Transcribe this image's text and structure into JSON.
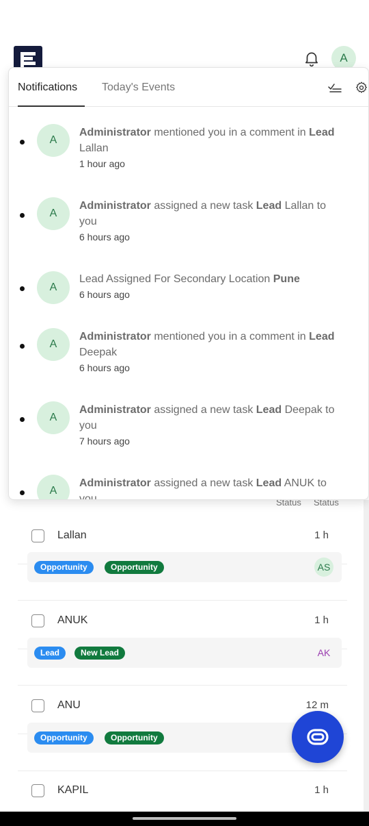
{
  "header": {
    "avatar_initial": "A"
  },
  "notifications_panel": {
    "tabs": [
      {
        "label": "Notifications",
        "active": true
      },
      {
        "label": "Today's Events",
        "active": false
      }
    ],
    "items": [
      {
        "avatar": "A",
        "actor": "Administrator",
        "text1": " mentioned you in a comment in ",
        "bold2": "Lead",
        "text2": "",
        "line2": "Lallan",
        "ago": "1 hour ago"
      },
      {
        "avatar": "A",
        "actor": "Administrator",
        "text1": " assigned a new task ",
        "bold2": "Lead",
        "text2": " Lallan to",
        "line2": "you",
        "ago": "6 hours ago"
      },
      {
        "avatar": "A",
        "actor": "",
        "text1": "Lead Assigned For Secondary Location ",
        "bold2": "Pune",
        "text2": "",
        "line2": "",
        "ago": "6 hours ago"
      },
      {
        "avatar": "A",
        "actor": "Administrator",
        "text1": " mentioned you in a comment in ",
        "bold2": "Lead",
        "text2": "",
        "line2": "Deepak",
        "ago": "6 hours ago"
      },
      {
        "avatar": "A",
        "actor": "Administrator",
        "text1": " assigned a new task ",
        "bold2": "Lead",
        "text2": " Deepak to",
        "line2": "you",
        "ago": "7 hours ago"
      },
      {
        "avatar": "A",
        "actor": "Administrator",
        "text1": " assigned a new task ",
        "bold2": "Lead",
        "text2": " ANUK to",
        "line2": "you",
        "ago": ""
      }
    ]
  },
  "list": {
    "column_headers": [
      "Status",
      "Status"
    ],
    "rows": [
      {
        "name": "Lallan",
        "time": "1 h",
        "tags": [
          {
            "label": "Opportunity",
            "color": "#2b8cf0"
          },
          {
            "label": "Opportunity",
            "color": "#117a3e"
          }
        ],
        "initials": "AS",
        "initials_color": "#2b7a4b",
        "initials_bg": "#d8f0de"
      },
      {
        "name": "ANUK",
        "time": "1 h",
        "tags": [
          {
            "label": "Lead",
            "color": "#2b8cf0"
          },
          {
            "label": "New Lead",
            "color": "#117a3e"
          }
        ],
        "initials": "AK",
        "initials_color": "#9b3fb0",
        "initials_bg": "transparent"
      },
      {
        "name": "ANU",
        "time": "12 m",
        "tags": [
          {
            "label": "Opportunity",
            "color": "#2b8cf0"
          },
          {
            "label": "Opportunity",
            "color": "#117a3e"
          }
        ],
        "initials": "",
        "initials_color": "",
        "initials_bg": "transparent"
      },
      {
        "name": "KAPIL",
        "time": "1 h",
        "tags": [],
        "initials": "",
        "initials_color": "",
        "initials_bg": "transparent"
      }
    ]
  },
  "colors": {
    "brand": "#141b3c",
    "fab": "#1f45d6",
    "avatar_bg": "#d8f0de"
  }
}
